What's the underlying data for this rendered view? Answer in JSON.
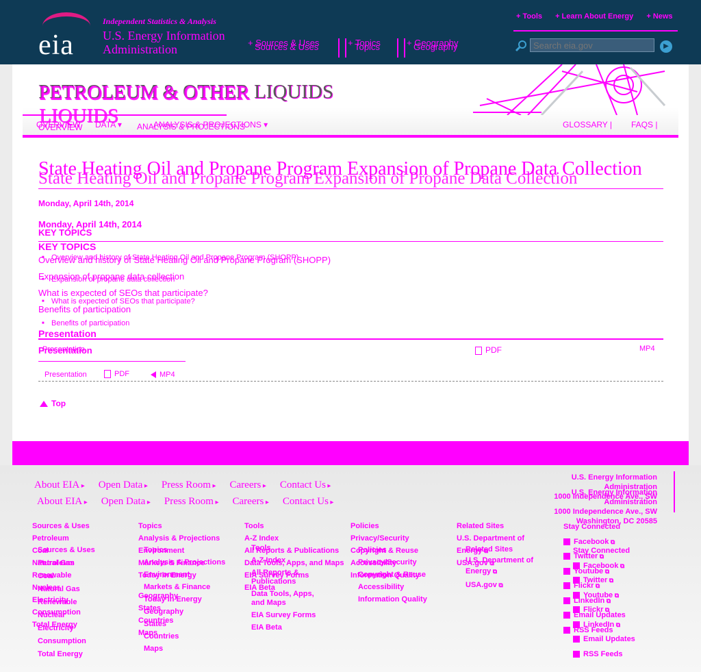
{
  "header": {
    "tagline": "Independent Statistics & Analysis",
    "agency": "U.S. Energy Information Administration",
    "logo_text": "eia",
    "util_nav": [
      "Tools",
      "Learn About Energy",
      "News"
    ],
    "search_placeholder": "Search eia.gov",
    "main_nav": [
      "Sources & Uses",
      "Topics",
      "Geography"
    ]
  },
  "banner": {
    "title": "PETROLEUM & OTHER LIQUIDS",
    "subnav_left": [
      "OVERVIEW",
      "DATA",
      "ANALYSIS & PROJECTIONS"
    ],
    "subnav_right": [
      "GLOSSARY",
      "FAQS"
    ]
  },
  "article": {
    "title": "State Heating Oil and Propane Program Expansion of Propane Data Collection",
    "date": "Monday, April 14th, 2014",
    "key_topics_heading": "KEY TOPICS",
    "topics": [
      "Overview and history of State Heating Oil and Propane Program (SHOPP)",
      "Expansion of propane data collection",
      "What is expected of SEOs that participate?",
      "Benefits of participation"
    ],
    "presentation_heading": "Presentation",
    "presentation_label": "Presentation",
    "pdf_label": "PDF",
    "mp4_label": "MP4",
    "top_label": "Top"
  },
  "footer": {
    "nav": [
      "About EIA",
      "Open Data",
      "Press Room",
      "Careers",
      "Contact Us"
    ],
    "address": [
      "U.S. Energy Information Administration",
      "1000 Independence Ave., SW",
      "Washington, DC 20585"
    ],
    "sources_uses": {
      "heading": "Sources & Uses",
      "items": [
        "Petroleum",
        "Coal",
        "Natural Gas",
        "Renewable",
        "Nuclear",
        "Electricity",
        "Consumption",
        "Total Energy"
      ]
    },
    "topics": {
      "heading": "Topics",
      "items": [
        "Analysis & Projections",
        "Environment",
        "Markets & Finance",
        "Today in Energy"
      ]
    },
    "geography": {
      "heading": "Geography",
      "items": [
        "States",
        "Countries",
        "Maps"
      ]
    },
    "tools": {
      "heading": "Tools",
      "items": [
        "A-Z Index",
        "All Reports & Publications",
        "Data Tools, Apps, and Maps",
        "EIA Survey Forms",
        "EIA Beta"
      ]
    },
    "policies": {
      "heading": "Policies",
      "items": [
        "Privacy/Security",
        "Copyright & Reuse",
        "Accessibility",
        "Information Quality"
      ]
    },
    "related": {
      "heading": "Related Sites",
      "items": [
        "U.S. Department of Energy",
        "USA.gov"
      ]
    },
    "connected": {
      "heading": "Stay Connected",
      "items": [
        "Facebook",
        "Twitter",
        "Youtube",
        "Flickr",
        "LinkedIn",
        "Email Updates",
        "RSS Feeds"
      ]
    }
  }
}
